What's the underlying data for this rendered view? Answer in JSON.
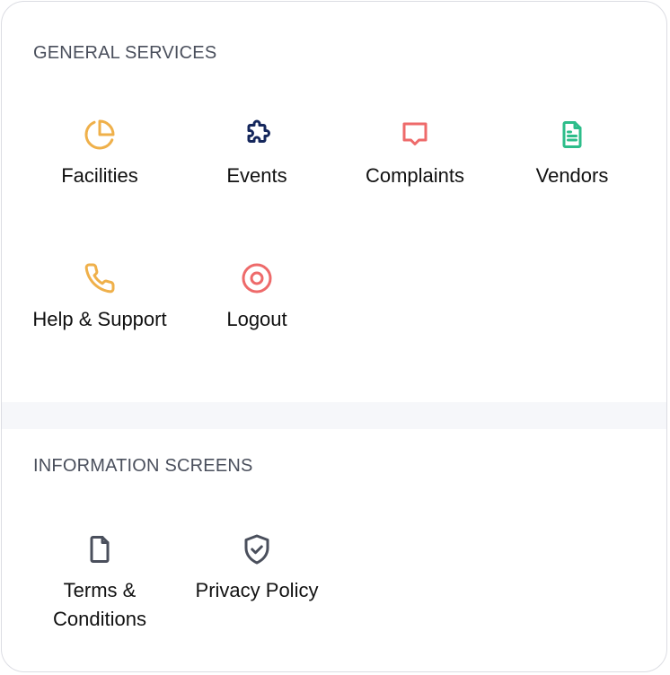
{
  "general_services": {
    "title": "GENERAL SERVICES",
    "items": [
      {
        "label": "Facilities",
        "icon": "pie-chart-icon",
        "color": "#efb04a"
      },
      {
        "label": "Events",
        "icon": "puzzle-icon",
        "color": "#15275c"
      },
      {
        "label": "Complaints",
        "icon": "chat-bubble-icon",
        "color": "#ee6a6a"
      },
      {
        "label": "Vendors",
        "icon": "document-text-icon",
        "color": "#2dbd8a"
      },
      {
        "label": "Help & Support",
        "icon": "phone-icon",
        "color": "#efb04a"
      },
      {
        "label": "Logout",
        "icon": "target-icon",
        "color": "#ee6a6a"
      }
    ]
  },
  "information_screens": {
    "title": "INFORMATION SCREENS",
    "items": [
      {
        "label": "Terms & Conditions",
        "icon": "file-icon",
        "color": "#4a4f5c"
      },
      {
        "label": "Privacy Policy",
        "icon": "shield-check-icon",
        "color": "#4a4f5c"
      }
    ]
  }
}
